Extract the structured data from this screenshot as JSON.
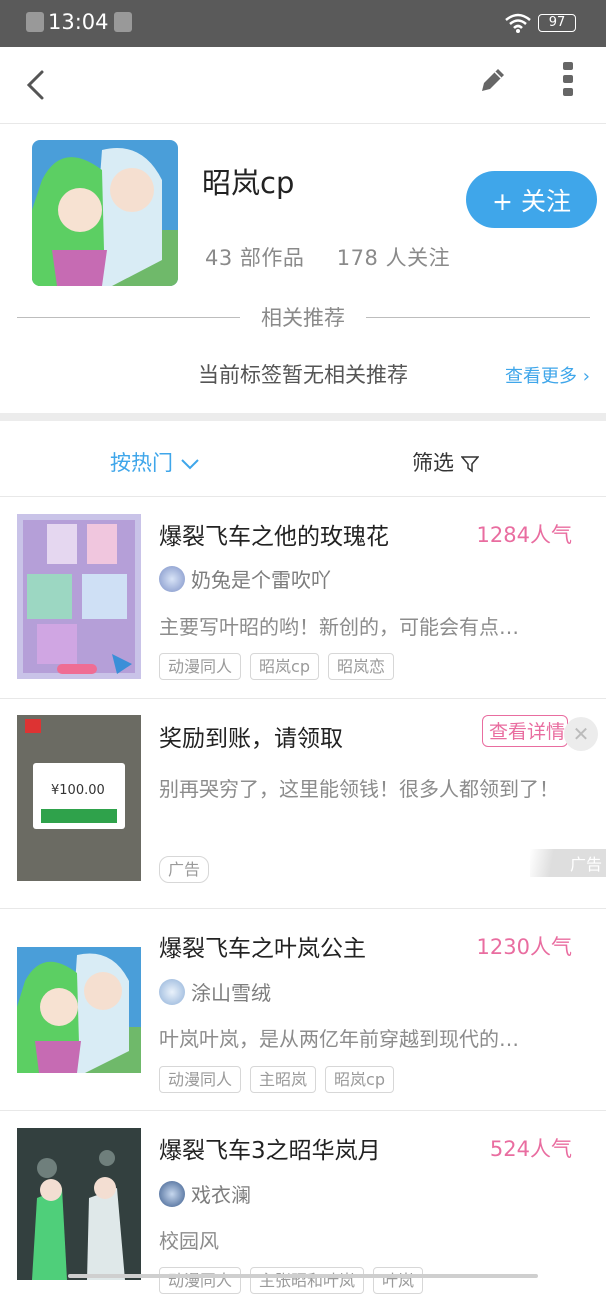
{
  "status_bar": {
    "time": "13:04",
    "battery": "97"
  },
  "topbar": {
    "back_icon": "back-arrow-icon",
    "edit_icon": "pencil-icon",
    "more_icon": "more-vertical-icon"
  },
  "tag": {
    "title": "昭岚cp",
    "follow_label": "+ 关注",
    "works_count": "43",
    "works_label": "部作品",
    "followers_count": "178",
    "followers_label": "人关注"
  },
  "related": {
    "title": "相关推荐",
    "empty_text": "当前标签暂无相关推荐",
    "see_more": "查看更多"
  },
  "filters": {
    "sort_label": "按热门",
    "filter_label": "筛选"
  },
  "works": [
    {
      "title": "爆裂飞车之他的玫瑰花",
      "popularity": "1284人气",
      "author": "奶兔是个雷吹吖",
      "summary": "主要写叶昭的哟！新创的，可能会有点…",
      "tags": [
        "动漫同人",
        "昭岚cp",
        "昭岚恋"
      ]
    },
    {
      "title": "爆裂飞车之叶岚公主",
      "popularity": "1230人气",
      "author": "涂山雪绒",
      "summary": "叶岚叶岚，是从两亿年前穿越到现代的…",
      "tags": [
        "动漫同人",
        "主昭岚",
        "昭岚cp"
      ]
    },
    {
      "title": "爆裂飞车3之昭华岚月",
      "popularity": "524人气",
      "author": "戏衣澜",
      "summary": "校园风",
      "tags": [
        "动漫同人",
        "主张昭和叶岚",
        "叶岚"
      ]
    }
  ],
  "ad": {
    "title": "奖励到账，请领取",
    "button": "查看详情",
    "summary": "别再哭穷了，这里能领钱！很多人都领到了！",
    "tag": "广告",
    "mark": "广告",
    "thumb_amount": "¥100.00"
  },
  "colors": {
    "accent": "#3fa6ea",
    "popularity": "#e96da0"
  }
}
